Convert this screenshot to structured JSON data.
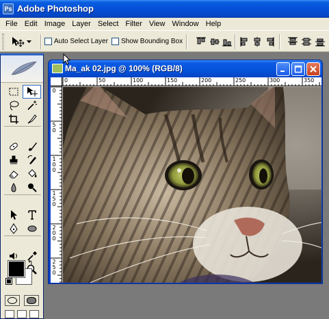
{
  "app": {
    "title": "Adobe Photoshop",
    "icon": "photoshop-app-icon"
  },
  "menu": [
    "File",
    "Edit",
    "Image",
    "Layer",
    "Select",
    "Filter",
    "View",
    "Window",
    "Help"
  ],
  "options": {
    "auto_select_label": "Auto Select Layer",
    "auto_select_checked": false,
    "bounding_box_label": "Show Bounding Box",
    "bounding_box_checked": false
  },
  "document": {
    "title": "Ma_ak 02.jpg @ 100% (RGB/8)",
    "ruler_h_labels": [
      "0",
      "50",
      "100",
      "150",
      "200",
      "250",
      "300",
      "350"
    ],
    "ruler_v_labels": [
      "0",
      "5\n0",
      "1\n0\n0",
      "1\n5\n0",
      "2\n0\n0",
      "2\n5\n0"
    ],
    "image_subject": "tabby-cat-photo"
  },
  "colors": {
    "foreground": "#000000",
    "background": "#ffffff",
    "xp_blue": "#0550d8"
  }
}
